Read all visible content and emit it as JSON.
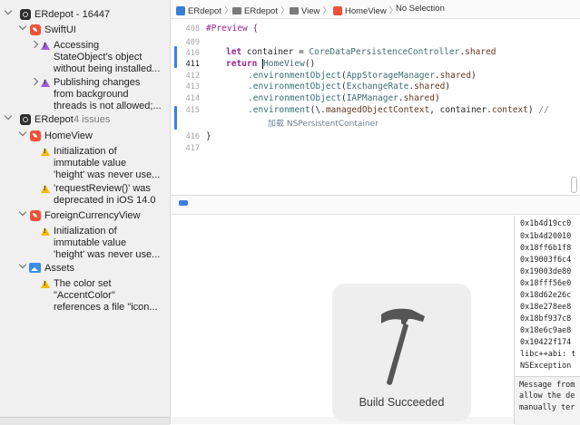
{
  "navigator": {
    "project1": {
      "title": "ERdepot - 16447"
    },
    "swiftui": {
      "title": "SwiftUI"
    },
    "issue_swiftui_1": "Accessing\nStateObject's object\nwithout being installed...",
    "issue_swiftui_2": "Publishing changes\nfrom background\nthreads is not allowed;...",
    "project2": {
      "title": "ERdepot",
      "count": "4 issues"
    },
    "homeview": {
      "title": "HomeView"
    },
    "issue_home_1": "Initialization of\nimmutable value\n'height' was never use...",
    "issue_home_2": "'requestReview()' was\ndeprecated in iOS 14.0",
    "foreign": {
      "title": "ForeignCurrencyView"
    },
    "issue_foreign_1": "Initialization of\nimmutable value\n'height' was never use...",
    "assets": {
      "title": "Assets"
    },
    "issue_assets_1": "The color set\n\"AccentColor\"\nreferences a file \"icon..."
  },
  "jumpbar": {
    "crumbs": [
      "ERdepot",
      "ERdepot",
      "View",
      "HomeView",
      "No Selection"
    ]
  },
  "editor": {
    "line_numbers": [
      "408",
      "409",
      "410",
      "411",
      "412",
      "413",
      "414",
      "415",
      "",
      "416",
      "417"
    ],
    "line_408": "#Preview {",
    "line_410": {
      "kw": "let",
      "rest": " container = ",
      "type": "CoreDataPersistenceController",
      "dot": ".",
      "prop": "shared"
    },
    "line_411": {
      "kw": "return",
      "cursor": " ",
      "type": "HomeView",
      "rest": "()"
    },
    "line_412": {
      "fn": ".environmentObject",
      "open": "(",
      "type": "AppStorageManager",
      "dot": ".",
      "prop": "shared",
      "close": ")"
    },
    "line_413": {
      "fn": ".environmentObject",
      "open": "(",
      "type": "ExchangeRate",
      "dot": ".",
      "prop": "shared",
      "close": ")"
    },
    "line_414": {
      "fn": ".environmentObject",
      "open": "(",
      "type": "IAPManager",
      "dot": ".",
      "prop": "shared",
      "close": ")"
    },
    "line_415": {
      "fn": ".environment",
      "a": "(\\.",
      "prop1": "managedObjectContext",
      "b": ", container.",
      "prop2": "context",
      "c": ") ",
      "comment": "//"
    },
    "line_415_wrap": {
      "comment": "加载 NSPersistentContainer"
    },
    "line_416": "}"
  },
  "console": {
    "lines": [
      "0x1b4d19cc0",
      "0x1b4d20010",
      "0x18ff6b1f8",
      "0x19003f6c4",
      "0x19003de80",
      "0x18fff56e0",
      "0x18d62e26c",
      "0x18e278ee8",
      "0x18bf937c8",
      "0x18e6c9ae8",
      "0x10422f174",
      "libc++abi: t",
      "NSException"
    ],
    "message": [
      "Message from",
      "allow the de",
      "manually ter"
    ]
  },
  "hud": {
    "label": "Build Succeeded",
    "icon": "hammer-icon"
  },
  "colors": {
    "accent": "#3b7ee5",
    "warning": "#f5b80b",
    "keyword": "#9b2393"
  }
}
